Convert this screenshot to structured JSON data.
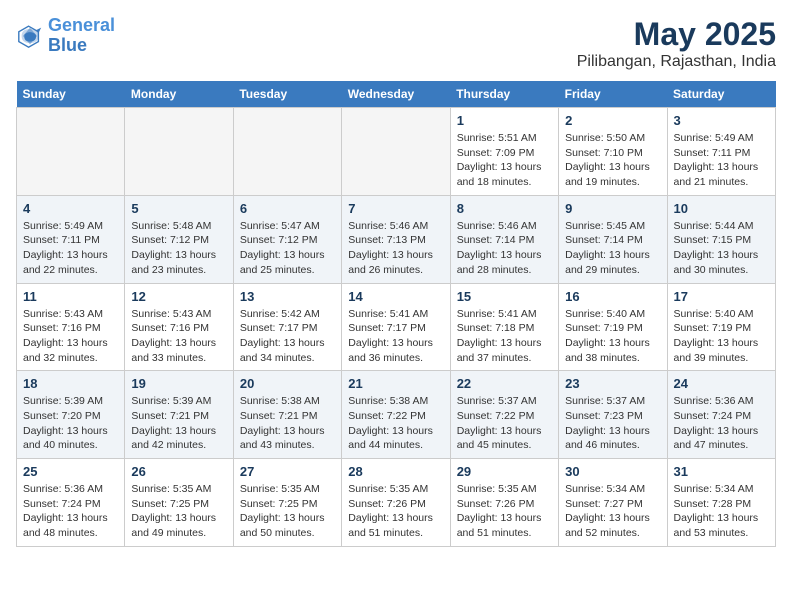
{
  "header": {
    "logo_line1": "General",
    "logo_line2": "Blue",
    "month": "May 2025",
    "location": "Pilibangan, Rajasthan, India"
  },
  "days_of_week": [
    "Sunday",
    "Monday",
    "Tuesday",
    "Wednesday",
    "Thursday",
    "Friday",
    "Saturday"
  ],
  "weeks": [
    [
      {
        "num": "",
        "empty": true
      },
      {
        "num": "",
        "empty": true
      },
      {
        "num": "",
        "empty": true
      },
      {
        "num": "",
        "empty": true
      },
      {
        "num": "1",
        "sunrise": "5:51 AM",
        "sunset": "7:09 PM",
        "daylight": "13 hours and 18 minutes."
      },
      {
        "num": "2",
        "sunrise": "5:50 AM",
        "sunset": "7:10 PM",
        "daylight": "13 hours and 19 minutes."
      },
      {
        "num": "3",
        "sunrise": "5:49 AM",
        "sunset": "7:11 PM",
        "daylight": "13 hours and 21 minutes."
      }
    ],
    [
      {
        "num": "4",
        "sunrise": "5:49 AM",
        "sunset": "7:11 PM",
        "daylight": "13 hours and 22 minutes."
      },
      {
        "num": "5",
        "sunrise": "5:48 AM",
        "sunset": "7:12 PM",
        "daylight": "13 hours and 23 minutes."
      },
      {
        "num": "6",
        "sunrise": "5:47 AM",
        "sunset": "7:12 PM",
        "daylight": "13 hours and 25 minutes."
      },
      {
        "num": "7",
        "sunrise": "5:46 AM",
        "sunset": "7:13 PM",
        "daylight": "13 hours and 26 minutes."
      },
      {
        "num": "8",
        "sunrise": "5:46 AM",
        "sunset": "7:14 PM",
        "daylight": "13 hours and 28 minutes."
      },
      {
        "num": "9",
        "sunrise": "5:45 AM",
        "sunset": "7:14 PM",
        "daylight": "13 hours and 29 minutes."
      },
      {
        "num": "10",
        "sunrise": "5:44 AM",
        "sunset": "7:15 PM",
        "daylight": "13 hours and 30 minutes."
      }
    ],
    [
      {
        "num": "11",
        "sunrise": "5:43 AM",
        "sunset": "7:16 PM",
        "daylight": "13 hours and 32 minutes."
      },
      {
        "num": "12",
        "sunrise": "5:43 AM",
        "sunset": "7:16 PM",
        "daylight": "13 hours and 33 minutes."
      },
      {
        "num": "13",
        "sunrise": "5:42 AM",
        "sunset": "7:17 PM",
        "daylight": "13 hours and 34 minutes."
      },
      {
        "num": "14",
        "sunrise": "5:41 AM",
        "sunset": "7:17 PM",
        "daylight": "13 hours and 36 minutes."
      },
      {
        "num": "15",
        "sunrise": "5:41 AM",
        "sunset": "7:18 PM",
        "daylight": "13 hours and 37 minutes."
      },
      {
        "num": "16",
        "sunrise": "5:40 AM",
        "sunset": "7:19 PM",
        "daylight": "13 hours and 38 minutes."
      },
      {
        "num": "17",
        "sunrise": "5:40 AM",
        "sunset": "7:19 PM",
        "daylight": "13 hours and 39 minutes."
      }
    ],
    [
      {
        "num": "18",
        "sunrise": "5:39 AM",
        "sunset": "7:20 PM",
        "daylight": "13 hours and 40 minutes."
      },
      {
        "num": "19",
        "sunrise": "5:39 AM",
        "sunset": "7:21 PM",
        "daylight": "13 hours and 42 minutes."
      },
      {
        "num": "20",
        "sunrise": "5:38 AM",
        "sunset": "7:21 PM",
        "daylight": "13 hours and 43 minutes."
      },
      {
        "num": "21",
        "sunrise": "5:38 AM",
        "sunset": "7:22 PM",
        "daylight": "13 hours and 44 minutes."
      },
      {
        "num": "22",
        "sunrise": "5:37 AM",
        "sunset": "7:22 PM",
        "daylight": "13 hours and 45 minutes."
      },
      {
        "num": "23",
        "sunrise": "5:37 AM",
        "sunset": "7:23 PM",
        "daylight": "13 hours and 46 minutes."
      },
      {
        "num": "24",
        "sunrise": "5:36 AM",
        "sunset": "7:24 PM",
        "daylight": "13 hours and 47 minutes."
      }
    ],
    [
      {
        "num": "25",
        "sunrise": "5:36 AM",
        "sunset": "7:24 PM",
        "daylight": "13 hours and 48 minutes."
      },
      {
        "num": "26",
        "sunrise": "5:35 AM",
        "sunset": "7:25 PM",
        "daylight": "13 hours and 49 minutes."
      },
      {
        "num": "27",
        "sunrise": "5:35 AM",
        "sunset": "7:25 PM",
        "daylight": "13 hours and 50 minutes."
      },
      {
        "num": "28",
        "sunrise": "5:35 AM",
        "sunset": "7:26 PM",
        "daylight": "13 hours and 51 minutes."
      },
      {
        "num": "29",
        "sunrise": "5:35 AM",
        "sunset": "7:26 PM",
        "daylight": "13 hours and 51 minutes."
      },
      {
        "num": "30",
        "sunrise": "5:34 AM",
        "sunset": "7:27 PM",
        "daylight": "13 hours and 52 minutes."
      },
      {
        "num": "31",
        "sunrise": "5:34 AM",
        "sunset": "7:28 PM",
        "daylight": "13 hours and 53 minutes."
      }
    ]
  ],
  "labels": {
    "sunrise": "Sunrise:",
    "sunset": "Sunset:",
    "daylight": "Daylight:"
  }
}
